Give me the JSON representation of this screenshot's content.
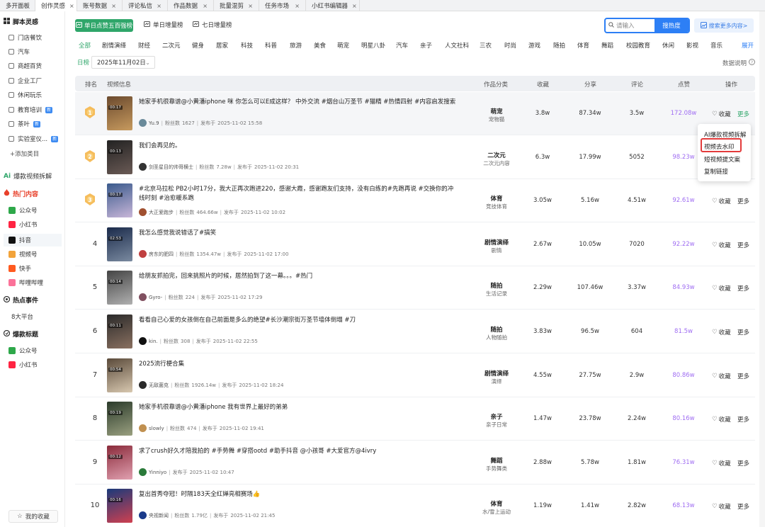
{
  "tabs": [
    {
      "label": "多开面板",
      "closable": false,
      "active": false
    },
    {
      "label": "创作灵感",
      "closable": true,
      "active": true
    },
    {
      "label": "账号数据",
      "closable": true,
      "active": false
    },
    {
      "label": "评论私信",
      "closable": true,
      "active": false
    },
    {
      "label": "作品数据",
      "closable": true,
      "active": false
    },
    {
      "label": "批量混剪",
      "closable": true,
      "active": false
    },
    {
      "label": "任务市场",
      "closable": true,
      "active": false
    },
    {
      "label": "小红书编辑器",
      "closable": true,
      "active": false
    }
  ],
  "sidebar": {
    "sec1_title": "脚本灵感",
    "sec1_items": [
      {
        "label": "门店餐饮",
        "icon": "store-icon"
      },
      {
        "label": "汽车",
        "icon": "car-icon"
      },
      {
        "label": "商超百货",
        "icon": "shop-icon"
      },
      {
        "label": "企业工厂",
        "icon": "factory-icon"
      },
      {
        "label": "休闲玩乐",
        "icon": "leisure-icon"
      },
      {
        "label": "教育培训",
        "icon": "edu-icon",
        "badge": "新"
      },
      {
        "label": "茶叶",
        "icon": "tea-icon",
        "badge": "新"
      },
      {
        "label": "实验室仪...",
        "icon": "lab-icon",
        "badge": "新"
      }
    ],
    "add_category": "+添加类目",
    "ai_label": "爆款视频拆解",
    "sec2_title": "热门内容",
    "sec2_items": [
      {
        "label": "公众号",
        "icon": "wechat-icon",
        "color": "#2ea84a"
      },
      {
        "label": "小红书",
        "icon": "xiaohongshu-icon",
        "color": "#ff2442"
      },
      {
        "label": "抖音",
        "icon": "douyin-icon",
        "color": "#111111",
        "active": true
      },
      {
        "label": "视频号",
        "icon": "channels-icon",
        "color": "#f2a33a"
      },
      {
        "label": "快手",
        "icon": "kuaishou-icon",
        "color": "#ff5a1f"
      },
      {
        "label": "哔哩哔哩",
        "icon": "bilibili-icon",
        "color": "#fb7299"
      }
    ],
    "sec3_title": "热点事件",
    "sec3_items": [
      {
        "label": "8大平台"
      }
    ],
    "sec4_title": "爆款标题",
    "sec4_items": [
      {
        "label": "公众号",
        "icon": "wechat-icon",
        "color": "#2ea84a"
      },
      {
        "label": "小红书",
        "icon": "xiaohongshu-icon",
        "color": "#ff2442"
      }
    ],
    "favorites": "我的收藏"
  },
  "toolbar": {
    "rank_tabs": [
      "单日点赞五百强榜",
      "单日增量榜",
      "七日增量榜"
    ],
    "search_placeholder": "请输入",
    "search_button": "搜热度",
    "search_more": "搜索更多内容>"
  },
  "categories": [
    "全部",
    "剧情演绎",
    "财经",
    "二次元",
    "健身",
    "居家",
    "科技",
    "科普",
    "旅游",
    "美食",
    "萌宠",
    "明星八卦",
    "汽车",
    "亲子",
    "人文社科",
    "三农",
    "时尚",
    "游戏",
    "随拍",
    "体育",
    "舞蹈",
    "校园教育",
    "休闲",
    "影视",
    "音乐"
  ],
  "expand": "展开",
  "date": {
    "label": "日榜",
    "value": "2025年11月02日"
  },
  "data_note": "数据说明",
  "table": {
    "headers": [
      "排名",
      "视频信息",
      "作品分类",
      "收藏",
      "分享",
      "评论",
      "点赞",
      "操作"
    ],
    "fans_prefix": "粉丝数",
    "pub_prefix": "发布于",
    "fav_label": "收藏",
    "more_label": "更多",
    "rows": [
      {
        "rank": "1",
        "duration": "00:17",
        "title": "她家手机很靠谱@小黄潘iphone 咪 你怎么可以E成这样？ 中外交流 #烟台山万圣节 #猫精 #热情四射 #内容启发搜索",
        "author": "Yu.9",
        "fans": "1627",
        "date": "2025-11-02 15:58",
        "cat": "萌宠",
        "subcat": "宠物猫",
        "fav": "3.8w",
        "share": "87.34w",
        "comment": "3.5w",
        "like": "172.08w"
      },
      {
        "rank": "2",
        "duration": "00:13",
        "title": "我们会再见的。",
        "author": "剑圣星目的帅哥横士",
        "fans": "7.28w",
        "date": "2025-11-02 20:31",
        "cat": "二次元",
        "subcat": "二次元内容",
        "fav": "6.3w",
        "share": "17.99w",
        "comment": "5052",
        "like": "98.23w"
      },
      {
        "rank": "3",
        "duration": "00:17",
        "title": "#北京马拉松 PB2小时17分，我大正再次跑进220，感谢大霞，感谢跑友们支持，没有白练的#先跑再说 #交换你的冲线时刻 #治愈暖系跑",
        "author": "大正爱跑步",
        "fans": "464.66w",
        "date": "2025-11-02 10:02",
        "cat": "体育",
        "subcat": "竞技体育",
        "fav": "3.05w",
        "share": "5.16w",
        "comment": "4.51w",
        "like": "92.61w"
      },
      {
        "rank": "4",
        "duration": "02:53",
        "title": "我怎么感觉我说错话了#搞笑",
        "author": "房东的肥四",
        "fans": "1354.47w",
        "date": "2025-11-02 17:00",
        "cat": "剧情演绎",
        "subcat": "剧情",
        "fav": "2.67w",
        "share": "10.05w",
        "comment": "7020",
        "like": "92.22w"
      },
      {
        "rank": "5",
        "duration": "00:14",
        "title": "给朋友抓拍完，回来挑照片的时候，居然拍到了这一幕。。。#热门",
        "author": "Gyro-",
        "fans": "224",
        "date": "2025-11-02 17:29",
        "cat": "随拍",
        "subcat": "生活记录",
        "fav": "2.29w",
        "share": "107.46w",
        "comment": "3.37w",
        "like": "84.93w"
      },
      {
        "rank": "6",
        "duration": "00:11",
        "title": "看看自己心爱的女孩倒在自己前面是多么的绝望#长沙潮宗街万圣节墙体倒塌 #刀",
        "author": "kin.",
        "fans": "308",
        "date": "2025-11-02 22:55",
        "cat": "随拍",
        "subcat": "人物随拍",
        "fav": "3.83w",
        "share": "96.5w",
        "comment": "604",
        "like": "81.5w"
      },
      {
        "rank": "7",
        "duration": "00:54",
        "title": "2025流行梗合集",
        "author": "无敌菌克",
        "fans": "1926.14w",
        "date": "2025-11-02 18:24",
        "cat": "剧情演绎",
        "subcat": "演绎",
        "fav": "4.55w",
        "share": "27.75w",
        "comment": "2.9w",
        "like": "80.86w"
      },
      {
        "rank": "8",
        "duration": "00:19",
        "title": "她家手机很靠谱@小黄潘iphone 我有世界上最好的弟弟",
        "author": "slowly",
        "fans": "474",
        "date": "2025-11-02 19:41",
        "cat": "亲子",
        "subcat": "亲子日常",
        "fav": "1.47w",
        "share": "23.78w",
        "comment": "2.24w",
        "like": "80.16w"
      },
      {
        "rank": "9",
        "duration": "00:12",
        "title": "求了crush好久才陪我拍的 #手势舞 #穿搭ootd #助手抖音 @小孩哥 #大爱官方@4ivry",
        "author": "Yinniyo",
        "fans": "",
        "date": "2025-11-02 10:47",
        "cat": "舞蹈",
        "subcat": "手势舞类",
        "fav": "2.88w",
        "share": "5.78w",
        "comment": "1.81w",
        "like": "76.31w"
      },
      {
        "rank": "10",
        "duration": "00:16",
        "title": "复出首秀夺冠！时隔183天全红婵亮相赛场👍",
        "author": "央视新闻",
        "fans": "1.79亿",
        "date": "2025-11-02 21:45",
        "cat": "体育",
        "subcat": "水/雪上运动",
        "fav": "1.19w",
        "share": "1.41w",
        "comment": "2.82w",
        "like": "68.13w"
      }
    ]
  },
  "dropdown": {
    "items": [
      "AI爆款视频拆解",
      "视频去水印",
      "短视频提文案",
      "复制链接"
    ],
    "highlighted_index": 1
  },
  "colors": {
    "accent_green": "#2fa66a",
    "accent_blue": "#2d7ff5",
    "like_purple": "#a06ef2",
    "medal_gold": "#f4b23f",
    "highlight_red": "#e33b3b"
  }
}
